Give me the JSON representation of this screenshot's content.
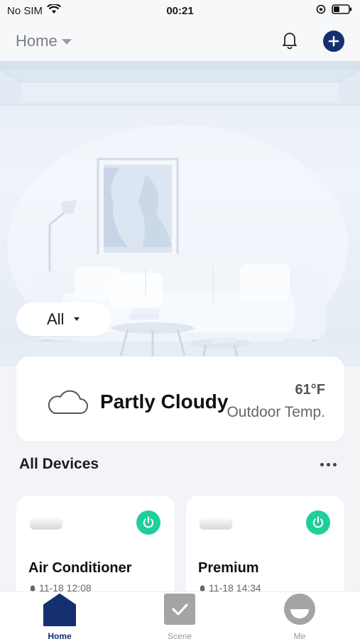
{
  "status_bar": {
    "carrier": "No SIM",
    "time": "00:21"
  },
  "header": {
    "home_label": "Home"
  },
  "filter": {
    "label": "All"
  },
  "weather": {
    "condition": "Partly Cloudy",
    "temperature": "61°F",
    "temperature_label": "Outdoor Temp."
  },
  "devices": {
    "section_title": "All Devices",
    "items": [
      {
        "name": "Air Conditioner",
        "time": "11-18 12:08"
      },
      {
        "name": "Premium",
        "time": "11-18 14:34"
      }
    ]
  },
  "tabs": [
    {
      "label": "Home"
    },
    {
      "label": "Scene"
    },
    {
      "label": "Me"
    }
  ],
  "colors": {
    "accent": "#14306f",
    "power": "#1fcf9b"
  }
}
